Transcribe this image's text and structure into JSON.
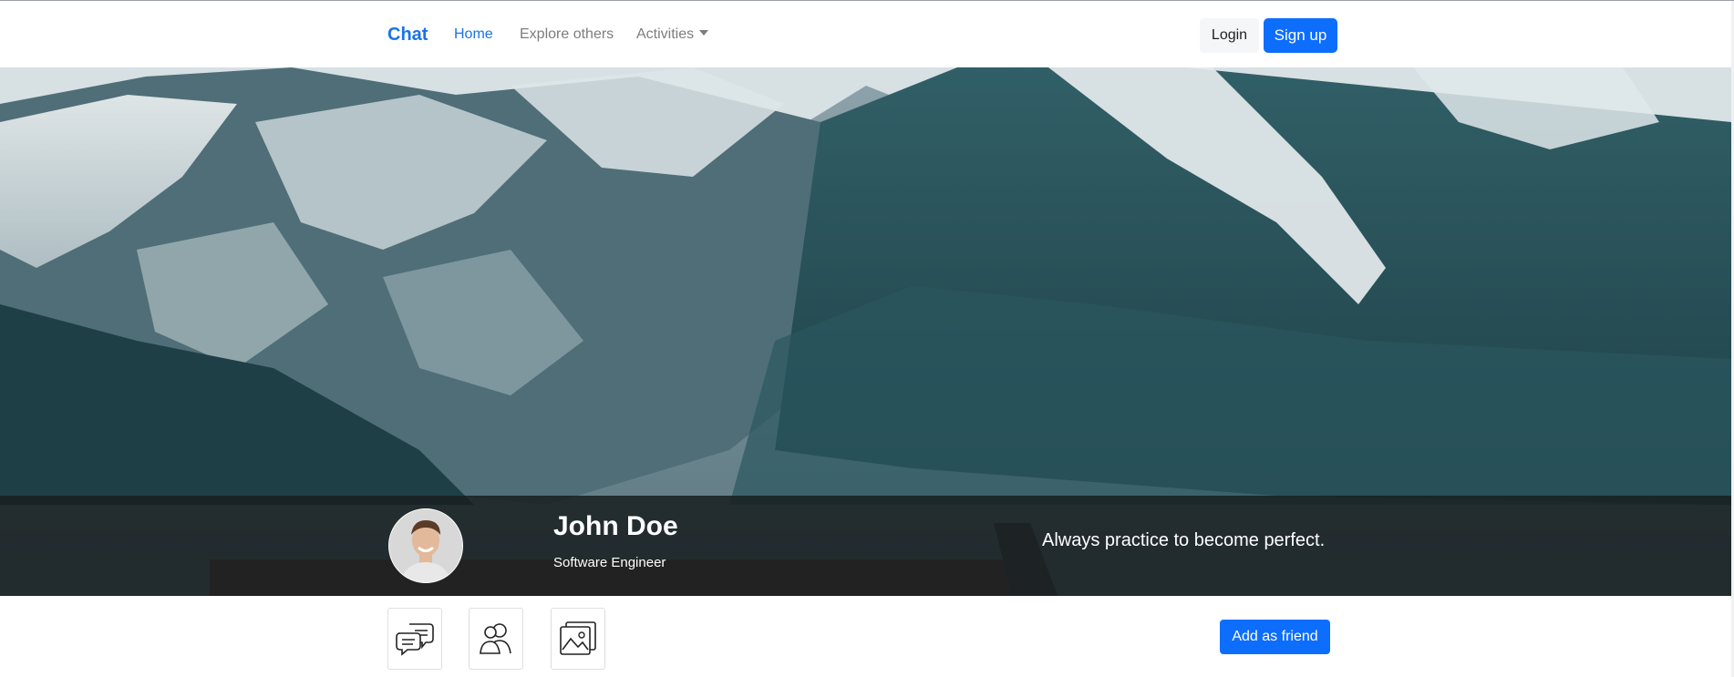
{
  "navbar": {
    "brand": "Chat",
    "links": {
      "home": "Home",
      "explore": "Explore others",
      "activities": "Activities"
    },
    "login": "Login",
    "signup": "Sign up"
  },
  "profile": {
    "name": "John Doe",
    "title": "Software Engineer",
    "quote": "Always practice to become perfect."
  },
  "actions": {
    "icons": [
      "chat-icon",
      "friends-icon",
      "gallery-icon"
    ],
    "add_friend": "Add as friend"
  },
  "colors": {
    "accent": "#0d6efd",
    "brand": "#1a73e8"
  }
}
